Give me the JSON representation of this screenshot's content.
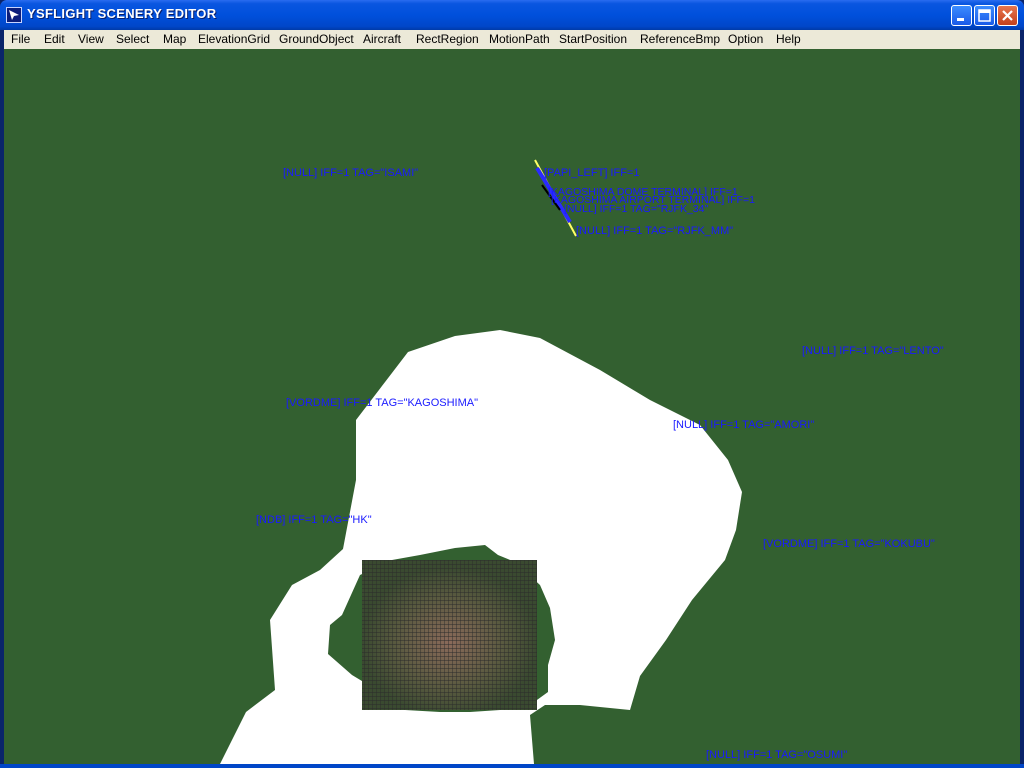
{
  "window": {
    "title": "YSFLIGHT SCENERY EDITOR",
    "controls": [
      "minimize",
      "maximize",
      "close"
    ]
  },
  "menu": {
    "items": [
      "File",
      "Edit",
      "View",
      "Select",
      "Map",
      "ElevationGrid",
      "GroundObject",
      "Aircraft",
      "RectRegion",
      "MotionPath",
      "StartPosition",
      "ReferenceBmp",
      "Option",
      "Help"
    ]
  },
  "scene": {
    "colors": {
      "ground": "#336030",
      "land": "#ffffff",
      "grid": "#2b2b2b",
      "label": "#1a1aff",
      "runway": "#ffff66"
    },
    "labels": {
      "isami": "[NULL] IFF=1 TAG=\"ISAMI\"",
      "papi_left": "[PAPI_LEFT] IFF=1",
      "dome_terminal": "[KAGOSHIMA DOME TERMINAL] IFF=1",
      "cluster_1": "[KAGOSHIMA AIRPORT TERMINAL] IFF=1",
      "cluster_2": "[NULL] IFF=1 TAG=\"RJFK_34\"",
      "rjfk_mm": "[NULL] IFF=1 TAG=\"RJFK_MM\"",
      "lento": "[NULL] IFF=1 TAG=\"LENTO\"",
      "kagoshima": "[VORDME] IFF=1 TAG=\"KAGOSHIMA\"",
      "amori": "[NULL] IFF=1 TAG=\"AMORI\"",
      "hk": "[NDB] IFF=1 TAG=\"HK\"",
      "kokubu": "[VORDME] IFF=1 TAG=\"KOKUBU\"",
      "osumi": "[NULL] IFF=1 TAG=\"OSUMI\""
    }
  }
}
